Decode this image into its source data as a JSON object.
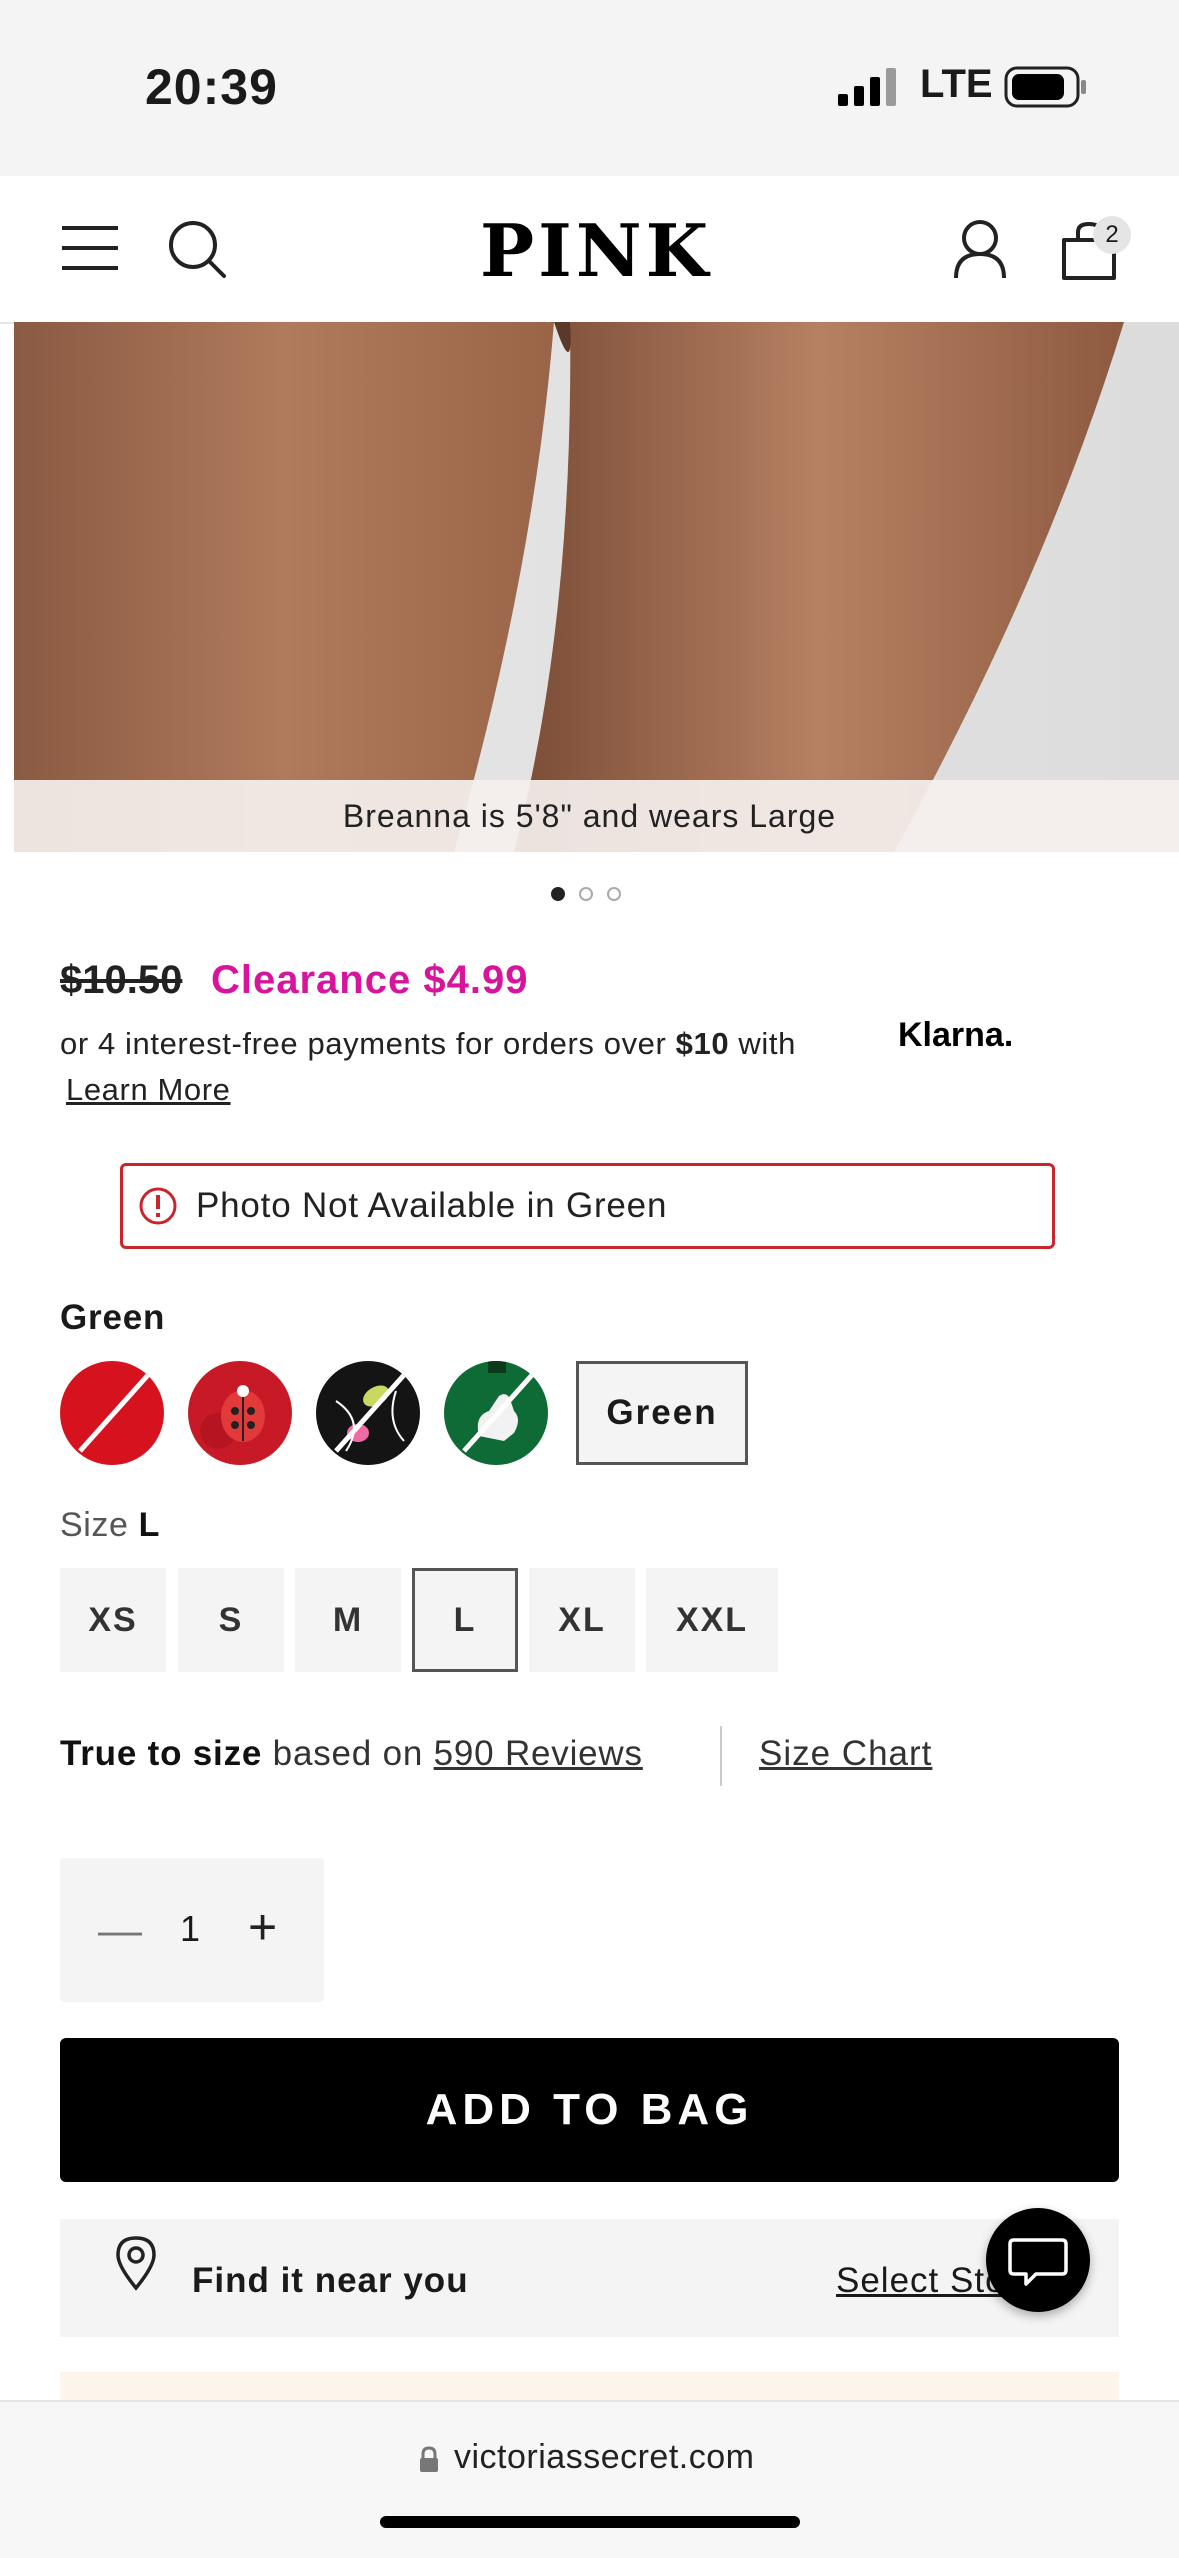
{
  "status_bar": {
    "time": "20:39",
    "network": "LTE"
  },
  "header": {
    "logo": "PINK",
    "cart_count": "2"
  },
  "product_image": {
    "caption": "Breanna is 5'8\" and wears Large",
    "carousel_pages": 3,
    "carousel_active": 1
  },
  "price": {
    "original": "$10.50",
    "clearance": "Clearance $4.99",
    "klarna_prefix": "or 4 interest-free payments for orders over ",
    "klarna_amount": "$10",
    "klarna_with": " with ",
    "klarna_logo": "Klarna.",
    "learn_more": "Learn More"
  },
  "alert": {
    "text": "Photo Not Available in Green",
    "color": "#c8262c"
  },
  "color": {
    "label": "Green",
    "swatches": [
      "red-unavailable",
      "red-ladybug",
      "black-floral-unavailable",
      "green-dog-unavailable"
    ],
    "selected_label": "Green"
  },
  "size": {
    "label": "Size",
    "selected": "L",
    "options": [
      "XS",
      "S",
      "M",
      "L",
      "XL",
      "XXL"
    ]
  },
  "fit": {
    "true_to_size": "True to size",
    "based_on": " based on ",
    "reviews": "590 Reviews",
    "size_chart": "Size Chart"
  },
  "quantity": {
    "value": "1"
  },
  "add_to_bag": "ADD TO BAG",
  "find": {
    "label": "Find it near you",
    "select_store": "Select Store"
  },
  "browser": {
    "url": "victoriassecret.com"
  },
  "colors": {
    "accent_pink": "#d6159c",
    "button_black": "#000000"
  }
}
